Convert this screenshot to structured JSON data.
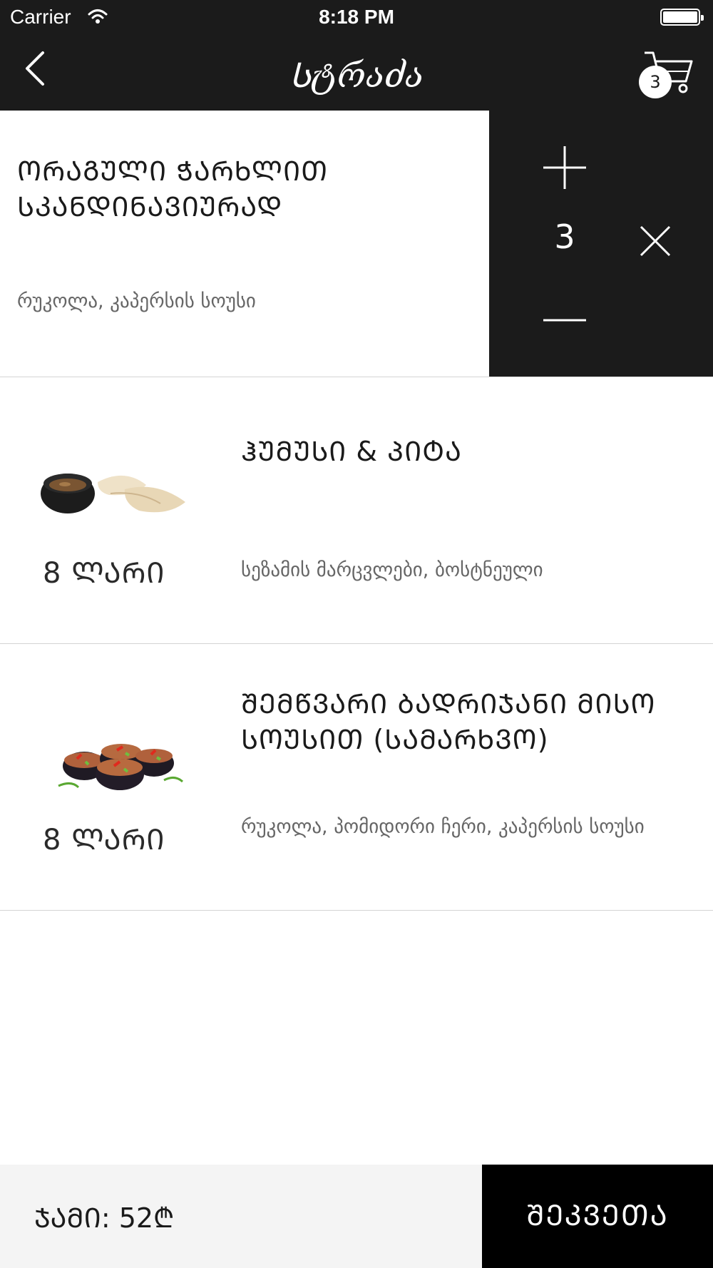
{
  "status_bar": {
    "carrier": "Carrier",
    "time": "8:18 PM"
  },
  "nav": {
    "title": "Სტრაძა",
    "cart_count": "3"
  },
  "selected_item": {
    "title": "ᲝᲠᲐᲒᲣᲚᲘ ᲭᲐᲠᲮᲚᲘᲗ ᲡᲙᲐᲜᲓᲘᲜᲐᲕᲘᲣᲠᲐᲓ",
    "description": "რუკოლა, კაპერსის სოუსი",
    "quantity": "3"
  },
  "items": [
    {
      "title": "ᲰᲣᲛᲣᲡᲘ & ᲞᲘᲢᲐ",
      "description": "სეზამის მარცვლები, ბოსტნეული",
      "price": "8 ᲚᲐᲠᲘ",
      "image": "hummus-pita-image"
    },
    {
      "title": "ᲨᲔᲛᲬᲕᲐᲠᲘ ᲑᲐᲓᲠᲘᲯᲐᲜᲘ ᲛᲘᲡᲝ ᲡᲝᲣᲡᲘᲗ (ᲡᲐᲛᲐᲠᲮᲕᲝ)",
      "description": "რუკოლა, პომიდორი ჩერი, კაპერსის სოუსი",
      "price": "8 ᲚᲐᲠᲘ",
      "image": "eggplant-rolls-image"
    }
  ],
  "footer": {
    "total": "ᲯᲐᲛᲘ: 52₾",
    "order_label": "ᲨᲔᲙᲕᲔᲗᲐ"
  },
  "colors": {
    "dark": "#1b1b1b",
    "footer_bg": "#f4f4f4",
    "order_bg": "#000000",
    "muted_text": "#666666"
  }
}
